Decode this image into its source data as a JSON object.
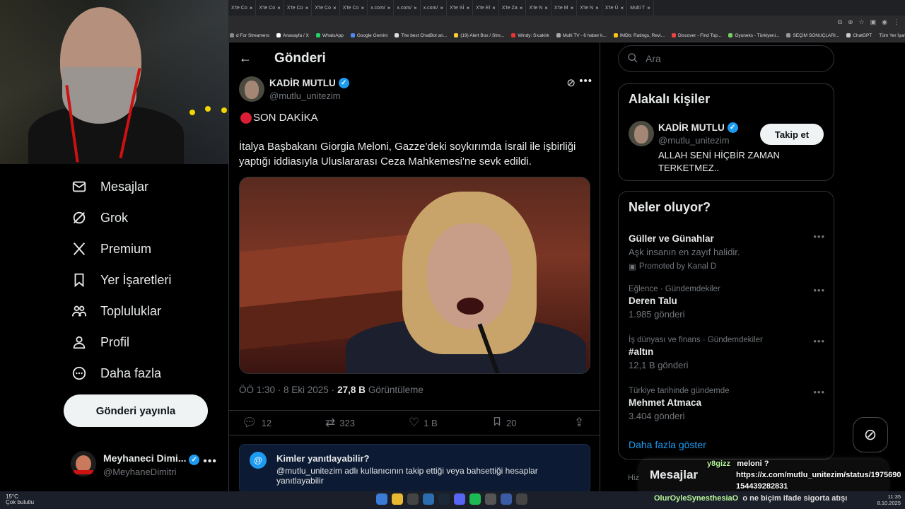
{
  "browser": {
    "tabs": [
      "X'te Co",
      "X'te Co",
      "X'te Co",
      "X'te Co",
      "X'te Co",
      "x.com/",
      "x.com/",
      "x.com/",
      "X'te Sİ",
      "X'te El",
      "X'te Za",
      "X'te N",
      "X'te M",
      "X'te N",
      "X'te Ü",
      "Multi T"
    ],
    "bookmarks": [
      "d For Streamers",
      "Anasayfa / X",
      "WhatsApp",
      "Google Gemini",
      "The best ChatBot an...",
      "(19) Alert Box / Stre...",
      "Windy: Sıcaklık",
      "Multi TV - 6 haber k...",
      "IMDb: Ratings, Revi...",
      "Discover - Find Top...",
      "Oyuneks - Türkiyeni...",
      "SEÇİM SONUÇLARI...",
      "ChatGPT"
    ],
    "all_bookmarks": "Tüm Yer İşaretleri"
  },
  "nav": {
    "items": [
      {
        "label": "Mesajlar",
        "icon": "mail-icon"
      },
      {
        "label": "Grok",
        "icon": "grok-icon"
      },
      {
        "label": "Premium",
        "icon": "x-logo-icon"
      },
      {
        "label": "Yer İşaretleri",
        "icon": "bookmark-icon"
      },
      {
        "label": "Topluluklar",
        "icon": "communities-icon"
      },
      {
        "label": "Profil",
        "icon": "profile-icon"
      },
      {
        "label": "Daha fazla",
        "icon": "more-circle-icon"
      }
    ],
    "post_button": "Gönderi yayınla",
    "account": {
      "name": "Meyhaneci Dimi...",
      "handle": "@MeyhaneDimitri"
    }
  },
  "post": {
    "header_title": "Gönderi",
    "author_name": "KADİR MUTLU",
    "author_handle": "@mutlu_unitezim",
    "breaking": "SON DAKİKA",
    "text_line1": "İtalya Başbakanı Giorgia Meloni, Gazze'deki soykırımda İsrail ile işbirliği",
    "text_line2": "yaptığı iddiasıyla Uluslararası Ceza Mahkemesi'ne sevk edildi.",
    "time": "ÖÖ 1:30 · 8 Eki 2025 ·",
    "views_count": "27,8 B",
    "views_label": "Görüntüleme",
    "replies": "12",
    "reposts": "323",
    "likes": "1 B",
    "bookmarks": "20",
    "reply_restriction_title": "Kimler yanıtlayabilir?",
    "reply_restriction_desc": "@mutlu_unitezim adlı kullanıcının takip ettiği veya bahsettiği hesaplar yanıtlayabilir"
  },
  "sidebar": {
    "search_placeholder": "Ara",
    "related_title": "Alakalı kişiler",
    "related_name": "KADİR MUTLU",
    "related_handle": "@mutlu_unitezim",
    "related_bio": "ALLAH SENİ HİÇBİR ZAMAN TERKETMEZ..",
    "follow_label": "Takip et",
    "trends_title": "Neler oluyor?",
    "trends": [
      {
        "name": "Güller ve Günahlar",
        "sub": "Aşk insanın en zayıf halidir.",
        "promo": "Promoted by Kanal D"
      },
      {
        "context": "Eğlence · Gündemdekiler",
        "name": "Deren Talu",
        "sub": "1.985 gönderi"
      },
      {
        "context": "İş dünyası ve finans · Gündemdekiler",
        "name": "#altın",
        "sub": "12,1 B gönderi"
      },
      {
        "context": "Türkiye tarihinde gündemde",
        "name": "Mehmet Atmaca",
        "sub": "3.404 gönderi"
      }
    ],
    "show_more": "Daha fazla göster",
    "messages_drawer": "Mesajlar",
    "partial_label": "Hizm"
  },
  "chat_overlay": {
    "user1": "y8gizz",
    "msg1_line1": "meloni ?",
    "msg1_line2": "https://x.com/mutlu_unitezim/status/1975690",
    "msg1_line3": "154439282831",
    "user2": "OlurOyleSynesthesiaO",
    "msg2": "o ne biçim ifade sigorta atışı"
  },
  "taskbar": {
    "temp": "15°C",
    "weather": "Çok bulutlu",
    "time": "11:35",
    "date": "8.10.2025"
  }
}
